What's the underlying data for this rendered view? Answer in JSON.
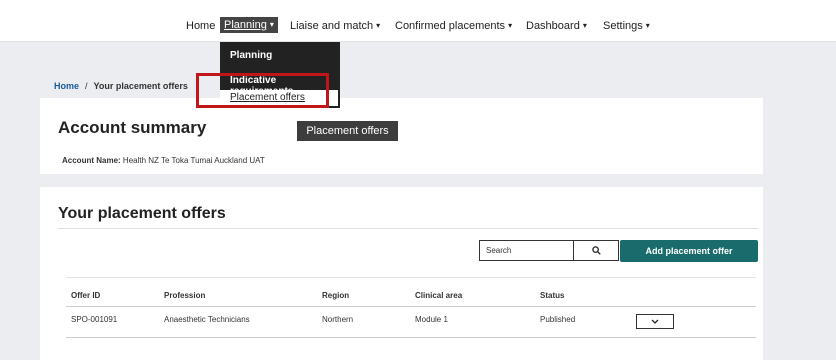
{
  "nav": {
    "home": "Home",
    "planning": "Planning",
    "liaise": "Liaise and match",
    "confirmed": "Confirmed placements",
    "dashboard": "Dashboard",
    "settings": "Settings"
  },
  "dropdown": {
    "header": "Planning",
    "items": [
      "Indicative requirements",
      "Placement offers"
    ]
  },
  "tooltip": "Placement offers",
  "breadcrumb": {
    "home": "Home",
    "separator": "/",
    "current": "Your placement offers"
  },
  "account": {
    "title": "Account summary",
    "name_label": "Account Name:",
    "name_value": "Health NZ Te Toka Tumai Auckland UAT"
  },
  "offers": {
    "title": "Your placement offers",
    "search_placeholder": "Search",
    "add_button": "Add placement offer",
    "columns": [
      "Offer ID",
      "Profession",
      "Region",
      "Clinical area",
      "Status"
    ],
    "rows": [
      {
        "offer_id": "SPO-001091",
        "profession": "Anaesthetic Technicians",
        "region": "Northern",
        "clinical_area": "Module 1",
        "status": "Published"
      }
    ]
  },
  "colors": {
    "accent": "#1a6c6c",
    "highlight": "#c0161a",
    "menu_bg": "#222222"
  }
}
